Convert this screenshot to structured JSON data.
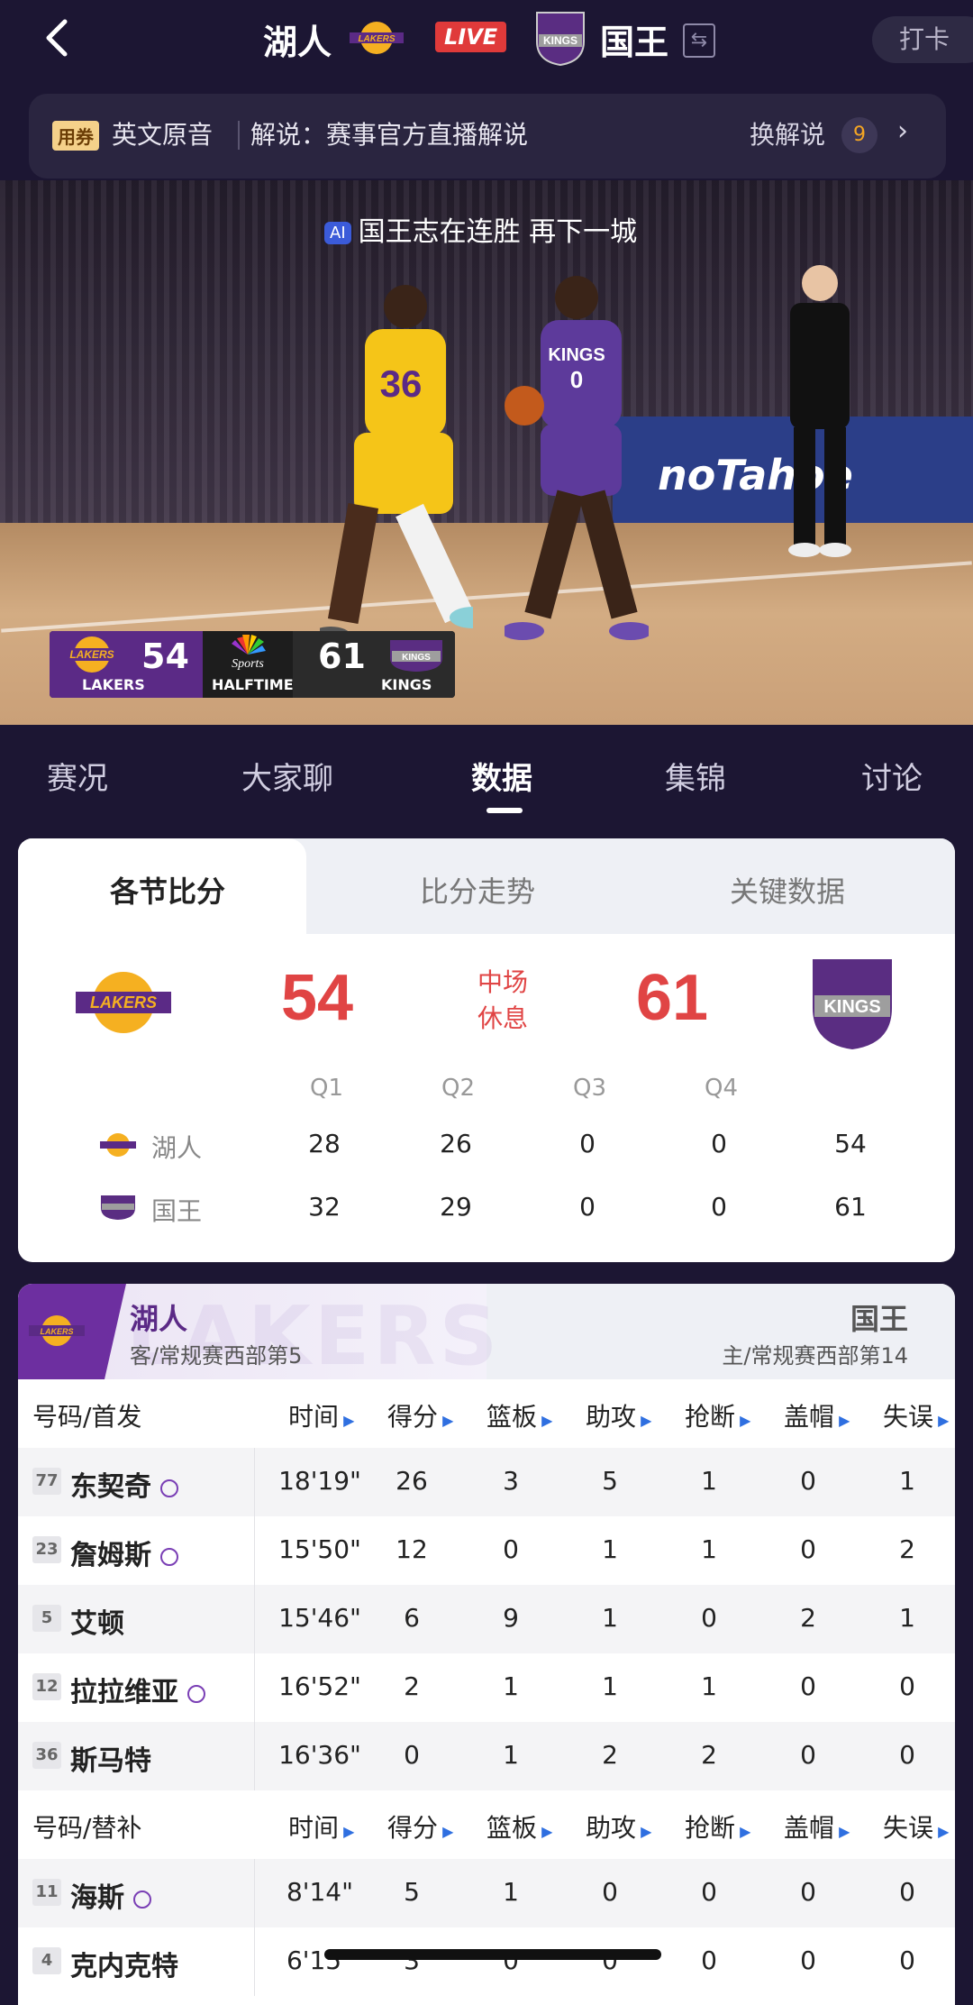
{
  "topbar": {
    "home_team": "湖人",
    "live": "LIVE",
    "away_team": "国王",
    "checkin": "打卡"
  },
  "commentary": {
    "coupon": "用券",
    "language": "英文原音",
    "commentator": "解说：赛事官方直播解说",
    "switch": "换解说",
    "count": "9"
  },
  "video": {
    "ai_badge": "AI",
    "caption": "国王志在连胜 再下一城",
    "ad": "noTahoe",
    "scorebug": {
      "lakers_score": "54",
      "lakers_label": "LAKERS",
      "period": "HALFTIME",
      "kings_score": "61",
      "kings_label": "KINGS"
    }
  },
  "tabs": [
    "赛况",
    "大家聊",
    "数据",
    "集锦",
    "讨论"
  ],
  "quarter_card": {
    "subtabs": [
      "各节比分",
      "比分走势",
      "关键数据"
    ],
    "lakers_score": "54",
    "kings_score": "61",
    "status_line1": "中场",
    "status_line2": "休息",
    "headers": [
      "Q1",
      "Q2",
      "Q3",
      "Q4"
    ],
    "rows": [
      {
        "team": "湖人",
        "q": [
          "28",
          "26",
          "0",
          "0"
        ],
        "total": "54"
      },
      {
        "team": "国王",
        "q": [
          "32",
          "29",
          "0",
          "0"
        ],
        "total": "61"
      }
    ]
  },
  "player_card": {
    "left_team": "湖人",
    "left_sub": "客/常规赛西部第5",
    "right_team": "国王",
    "right_sub": "主/常规赛西部第14",
    "watermark": "LAKERS",
    "starters_header": [
      "号码/首发",
      "时间",
      "得分",
      "篮板",
      "助攻",
      "抢断",
      "盖帽",
      "失误"
    ],
    "bench_header": [
      "号码/替补",
      "时间",
      "得分",
      "篮板",
      "助攻",
      "抢断",
      "盖帽",
      "失误"
    ],
    "starters": [
      {
        "num": "77",
        "name": "东契奇",
        "ball": true,
        "stats": [
          "18'19\"",
          "26",
          "3",
          "5",
          "1",
          "0",
          "1"
        ]
      },
      {
        "num": "23",
        "name": "詹姆斯",
        "ball": true,
        "stats": [
          "15'50\"",
          "12",
          "0",
          "1",
          "1",
          "0",
          "2"
        ]
      },
      {
        "num": "5",
        "name": "艾顿",
        "ball": false,
        "stats": [
          "15'46\"",
          "6",
          "9",
          "1",
          "0",
          "2",
          "1"
        ]
      },
      {
        "num": "12",
        "name": "拉拉维亚",
        "ball": true,
        "stats": [
          "16'52\"",
          "2",
          "1",
          "1",
          "1",
          "0",
          "0"
        ]
      },
      {
        "num": "36",
        "name": "斯马特",
        "ball": false,
        "stats": [
          "16'36\"",
          "0",
          "1",
          "2",
          "2",
          "0",
          "0"
        ]
      }
    ],
    "bench": [
      {
        "num": "11",
        "name": "海斯",
        "ball": true,
        "stats": [
          "8'14\"",
          "5",
          "1",
          "0",
          "0",
          "0",
          "0"
        ]
      },
      {
        "num": "4",
        "name": "克内克特",
        "ball": false,
        "stats": [
          "6'15\"",
          "3",
          "0",
          "0",
          "0",
          "0",
          "0"
        ]
      }
    ]
  }
}
